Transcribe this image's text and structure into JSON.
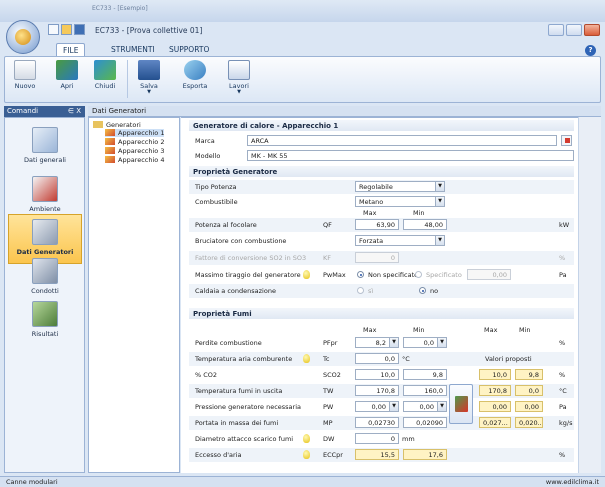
{
  "window": {
    "title": "EC733 - [Prova collettive 01]",
    "title_top": "EC733 - [Esempio]"
  },
  "ribbon": {
    "tabs": [
      {
        "label": "FILE",
        "active": true
      },
      {
        "label": "STRUMENTI"
      },
      {
        "label": "SUPPORTO"
      }
    ],
    "buttons": {
      "nuovo": "Nuovo",
      "apri": "Apri",
      "chiudi": "Chiudi",
      "salva": "Salva",
      "esporta": "Esporta",
      "lavori": "Lavori"
    }
  },
  "left_panel": {
    "title": "Comandi",
    "pin": "∈ X",
    "items": [
      {
        "label": "Dati generali",
        "icon": "edit-icon"
      },
      {
        "label": "Ambiente",
        "icon": "thermometer-icon"
      },
      {
        "label": "Dati Generatori",
        "icon": "boiler-icon",
        "selected": true
      },
      {
        "label": "Condotti",
        "icon": "pipe-icon"
      },
      {
        "label": "Risultati",
        "icon": "calculator-icon"
      }
    ]
  },
  "tree": {
    "header": "Dati Generatori",
    "root": "Generatori",
    "items": [
      "Apparecchio 1",
      "Apparecchio 2",
      "Apparecchio 3",
      "Apparecchio 4"
    ]
  },
  "form": {
    "section_title": "Generatore di calore - Apparecchio 1",
    "marca_label": "Marca",
    "marca_value": "ARCA",
    "modello_label": "Modello",
    "modello_value": "MK - MK 55",
    "prop_gen_title": "Proprietà Generatore",
    "tipo_potenza_label": "Tipo Potenza",
    "tipo_potenza_value": "Regolabile",
    "combustibile_label": "Combustibile",
    "combustibile_value": "Metano",
    "col_max": "Max",
    "col_min": "Min",
    "potenza_label": "Potenza al focolare",
    "potenza_sym": "QF",
    "potenza_max": "63,90",
    "potenza_min": "48,00",
    "potenza_unit": "kW",
    "bruciatore_label": "Bruciatore con combustione",
    "bruciatore_value": "Forzata",
    "fattore_label": "Fattore di conversione SO2 in SO3",
    "fattore_sym": "KF",
    "fattore_value": "0",
    "fattore_unit": "%",
    "tiraggio_label": "Massimo tiraggio del generatore",
    "tiraggio_sym": "PwMax",
    "tiraggio_opt1": "Non specificato",
    "tiraggio_opt2": "Specificato",
    "tiraggio_value": "0,00",
    "tiraggio_unit": "Pa",
    "caldaia_label": "Caldaia a condensazione",
    "caldaia_opt1": "sì",
    "caldaia_opt2": "no",
    "prop_fumi_title": "Proprietà Fumi",
    "valori_proposti": "Valori proposti",
    "fumi": [
      {
        "label": "Perdite combustione",
        "sym": "PFpr",
        "max": "8,2",
        "min": "0,0",
        "unit": "%",
        "bulb": false,
        "type": "select"
      },
      {
        "label": "Temperatura aria comburente",
        "sym": "Tc",
        "max": "0,0",
        "max_unit": "°C",
        "bulb": true,
        "type": "single"
      },
      {
        "label": "% CO2",
        "sym": "SCO2",
        "max": "10,0",
        "min": "9,8",
        "pmax": "10,0",
        "pmin": "9,8",
        "unit": "%",
        "bulb": false,
        "type": "pair"
      },
      {
        "label": "Temperatura fumi in uscita",
        "sym": "TW",
        "max": "170,8",
        "min": "160,0",
        "pmax": "170,8",
        "pmin": "0,0",
        "unit": "°C",
        "bulb": false,
        "type": "pair"
      },
      {
        "label": "Pressione generatore necessaria",
        "sym": "PW",
        "max": "0,00",
        "min": "0,00",
        "pmax": "0,00",
        "pmin": "0,00",
        "unit": "Pa",
        "bulb": false,
        "type": "select2"
      },
      {
        "label": "Portata in massa dei fumi",
        "sym": "MP",
        "max": "0,02730",
        "min": "0,02090",
        "pmax": "0,027...",
        "pmin": "0,020...",
        "unit": "kg/s",
        "bulb": false,
        "type": "pair"
      },
      {
        "label": "Diametro attacco scarico fumi",
        "sym": "DW",
        "max": "0",
        "max_unit": "mm",
        "bulb": true,
        "type": "single"
      },
      {
        "label": "Eccesso d'aria",
        "sym": "ECCpr",
        "max": "15,5",
        "min": "17,6",
        "unit": "%",
        "bulb": true,
        "type": "yellow"
      }
    ]
  },
  "status": {
    "left": "Canne modulari",
    "right": "www.edilclima.it"
  }
}
